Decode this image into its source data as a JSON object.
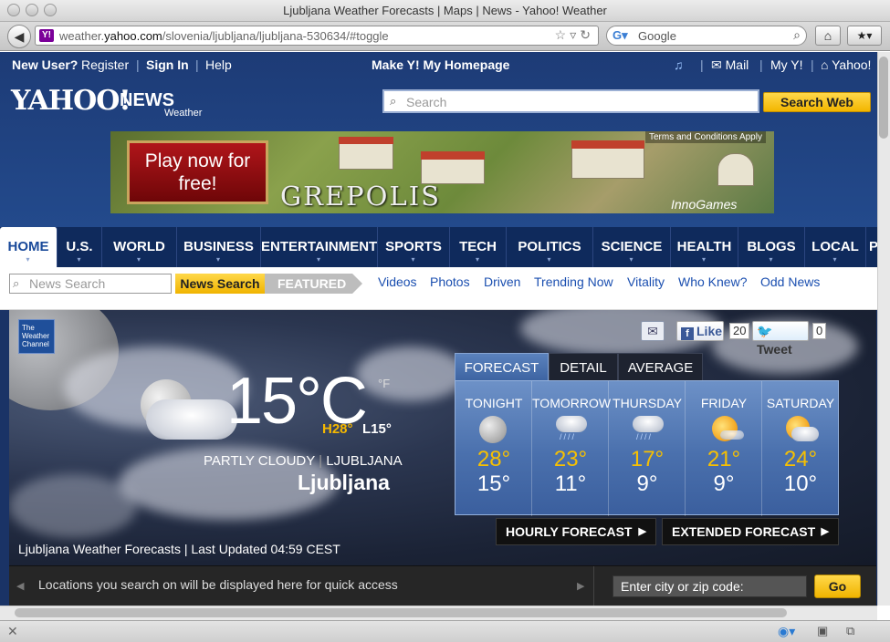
{
  "window": {
    "title": "Ljubljana Weather Forecasts | Maps | News - Yahoo! Weather"
  },
  "browser": {
    "url_prefix": "weather.",
    "url_domain": "yahoo.com",
    "url_path": "/slovenia/ljubljana/ljubljana-530634/#toggle",
    "search_engine": "Google"
  },
  "header": {
    "new_user": "New User?",
    "register": "Register",
    "sign_in": "Sign In",
    "help": "Help",
    "make_homepage": "Make Y! My Homepage",
    "mail": "Mail",
    "my_y": "My Y!",
    "yahoo_home": "Yahoo!",
    "logo_text": "YAHOO!",
    "logo_news": "NEWS",
    "logo_sub": "Weather",
    "search_placeholder": "Search",
    "search_button": "Search Web"
  },
  "ad": {
    "cta": "Play now for free!",
    "title": "GREPOLIS",
    "terms": "Terms and Conditions Apply",
    "brand": "InnoGames"
  },
  "nav": {
    "items": [
      "HOME",
      "U.S.",
      "WORLD",
      "BUSINESS",
      "ENTERTAINMENT",
      "SPORTS",
      "TECH",
      "POLITICS",
      "SCIENCE",
      "HEALTH",
      "BLOGS",
      "LOCAL",
      "P"
    ]
  },
  "subnav": {
    "search_placeholder": "News Search",
    "search_button": "News Search",
    "featured": "FEATURED",
    "links": [
      "Videos",
      "Photos",
      "Driven",
      "Trending Now",
      "Vitality",
      "Who Knew?",
      "Odd News"
    ]
  },
  "weather": {
    "provider_logo": "The Weather Channel",
    "temperature": "15°C",
    "alt_unit": "°F",
    "high": "H28°",
    "low": "L15°",
    "condition": "PARTLY CLOUDY",
    "location_upper": "LJUBLJANA",
    "city": "Ljubljana",
    "updated": "Ljubljana Weather Forecasts | Last Updated 04:59 CEST",
    "like_label": "Like",
    "like_count": "20",
    "tweet_label": "Tweet",
    "tweet_count": "0",
    "tabs": [
      "FORECAST",
      "DETAIL",
      "AVERAGE"
    ],
    "forecast": [
      {
        "day": "TONIGHT",
        "hi": "28°",
        "lo": "15°",
        "icon": "clear-night"
      },
      {
        "day": "TOMORROW",
        "hi": "23°",
        "lo": "11°",
        "icon": "rain"
      },
      {
        "day": "THURSDAY",
        "hi": "17°",
        "lo": "9°",
        "icon": "rain"
      },
      {
        "day": "FRIDAY",
        "hi": "21°",
        "lo": "9°",
        "icon": "sunny"
      },
      {
        "day": "SATURDAY",
        "hi": "24°",
        "lo": "10°",
        "icon": "partly-cloudy"
      }
    ],
    "hourly_button": "HOURLY FORECAST",
    "extended_button": "EXTENDED FORECAST"
  },
  "locations": {
    "hint": "Locations you search on will be displayed here for quick access",
    "input_placeholder": "Enter city or zip code:",
    "go_button": "Go"
  },
  "colors": {
    "yahoo_blue": "#1d3b76",
    "accent_yellow": "#f5b800",
    "link_blue": "#1b4fb0"
  }
}
